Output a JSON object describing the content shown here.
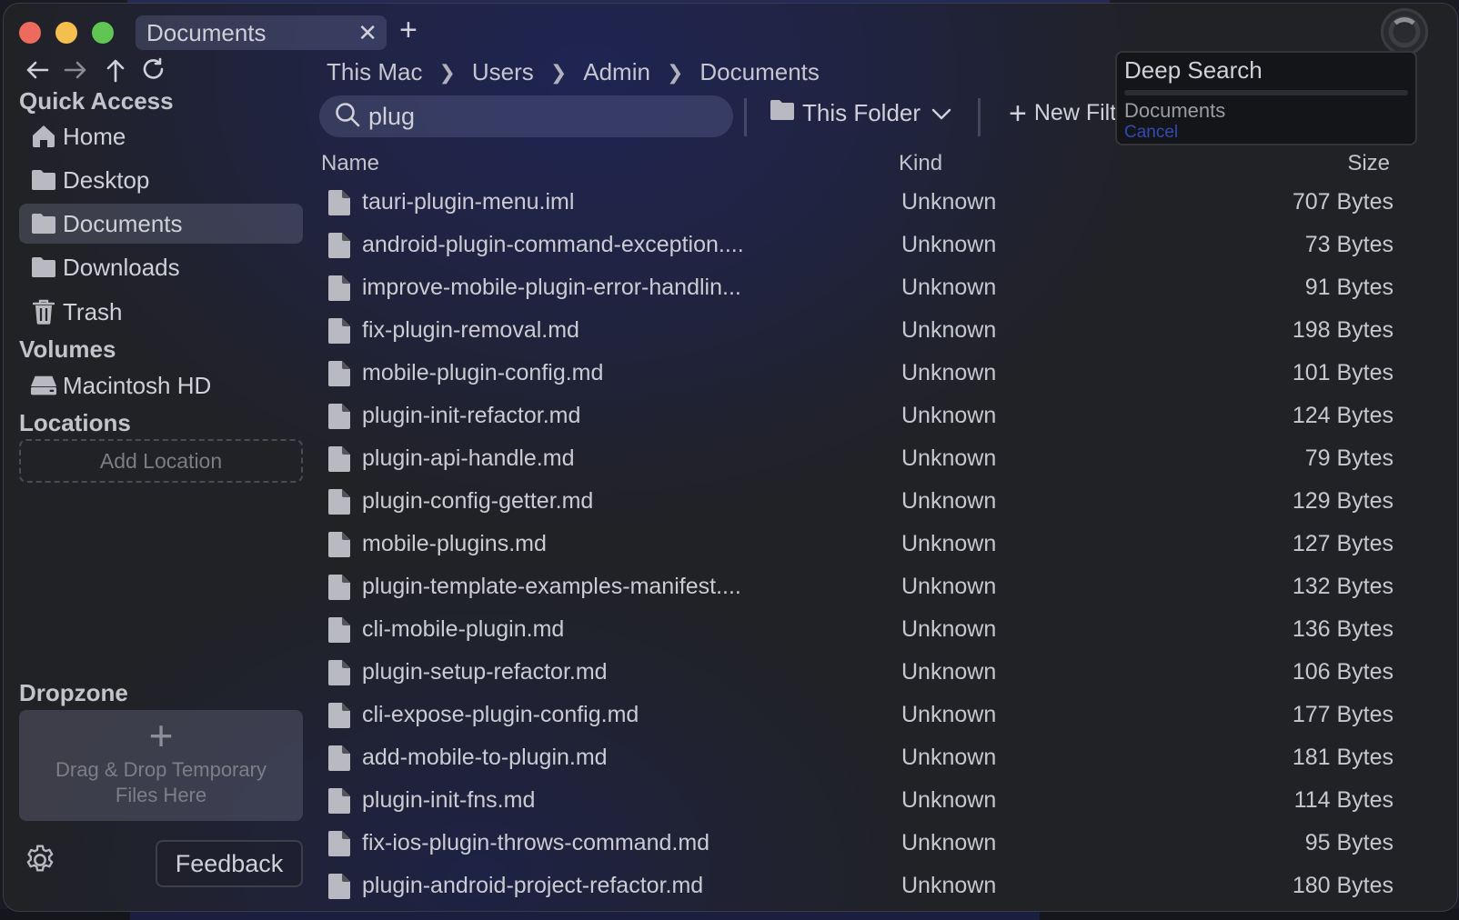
{
  "window": {
    "tab_label": "Documents"
  },
  "breadcrumb": [
    "This Mac",
    "Users",
    "Admin",
    "Documents"
  ],
  "sidebar": {
    "quick_access_heading": "Quick Access",
    "quick_access": [
      {
        "label": "Home",
        "icon": "home-icon"
      },
      {
        "label": "Desktop",
        "icon": "folder-icon"
      },
      {
        "label": "Documents",
        "icon": "folder-icon",
        "active": true
      },
      {
        "label": "Downloads",
        "icon": "folder-icon"
      },
      {
        "label": "Trash",
        "icon": "trash-icon"
      }
    ],
    "volumes_heading": "Volumes",
    "volumes": [
      {
        "label": "Macintosh HD",
        "icon": "hard-drive-icon"
      }
    ],
    "locations_heading": "Locations",
    "add_location_label": "Add Location",
    "dropzone_heading": "Dropzone",
    "dropzone_text": "Drag & Drop Temporary Files Here",
    "feedback_label": "Feedback"
  },
  "search": {
    "value": "plug",
    "scope_label": "This Folder",
    "new_filter_label": "New Filter"
  },
  "table": {
    "columns": {
      "name": "Name",
      "kind": "Kind",
      "size": "Size"
    },
    "rows": [
      {
        "name": "tauri-plugin-menu.iml",
        "kind": "Unknown",
        "size": "707 Bytes"
      },
      {
        "name": "android-plugin-command-exception....",
        "kind": "Unknown",
        "size": "73 Bytes"
      },
      {
        "name": "improve-mobile-plugin-error-handlin...",
        "kind": "Unknown",
        "size": "91 Bytes"
      },
      {
        "name": "fix-plugin-removal.md",
        "kind": "Unknown",
        "size": "198 Bytes"
      },
      {
        "name": "mobile-plugin-config.md",
        "kind": "Unknown",
        "size": "101 Bytes"
      },
      {
        "name": "plugin-init-refactor.md",
        "kind": "Unknown",
        "size": "124 Bytes"
      },
      {
        "name": "plugin-api-handle.md",
        "kind": "Unknown",
        "size": "79 Bytes"
      },
      {
        "name": "plugin-config-getter.md",
        "kind": "Unknown",
        "size": "129 Bytes"
      },
      {
        "name": "mobile-plugins.md",
        "kind": "Unknown",
        "size": "127 Bytes"
      },
      {
        "name": "plugin-template-examples-manifest....",
        "kind": "Unknown",
        "size": "132 Bytes"
      },
      {
        "name": "cli-mobile-plugin.md",
        "kind": "Unknown",
        "size": "136 Bytes"
      },
      {
        "name": "plugin-setup-refactor.md",
        "kind": "Unknown",
        "size": "106 Bytes"
      },
      {
        "name": "cli-expose-plugin-config.md",
        "kind": "Unknown",
        "size": "177 Bytes"
      },
      {
        "name": "add-mobile-to-plugin.md",
        "kind": "Unknown",
        "size": "181 Bytes"
      },
      {
        "name": "plugin-init-fns.md",
        "kind": "Unknown",
        "size": "114 Bytes"
      },
      {
        "name": "fix-ios-plugin-throws-command.md",
        "kind": "Unknown",
        "size": "95 Bytes"
      },
      {
        "name": "plugin-android-project-refactor.md",
        "kind": "Unknown",
        "size": "180 Bytes"
      }
    ]
  },
  "deep_search": {
    "title": "Deep Search",
    "location": "Documents",
    "cancel_label": "Cancel"
  },
  "colors": {
    "accent_link": "#3349b6",
    "traffic_red": "#ee6a5f",
    "traffic_yellow": "#f5bf4f",
    "traffic_green": "#61c554"
  }
}
